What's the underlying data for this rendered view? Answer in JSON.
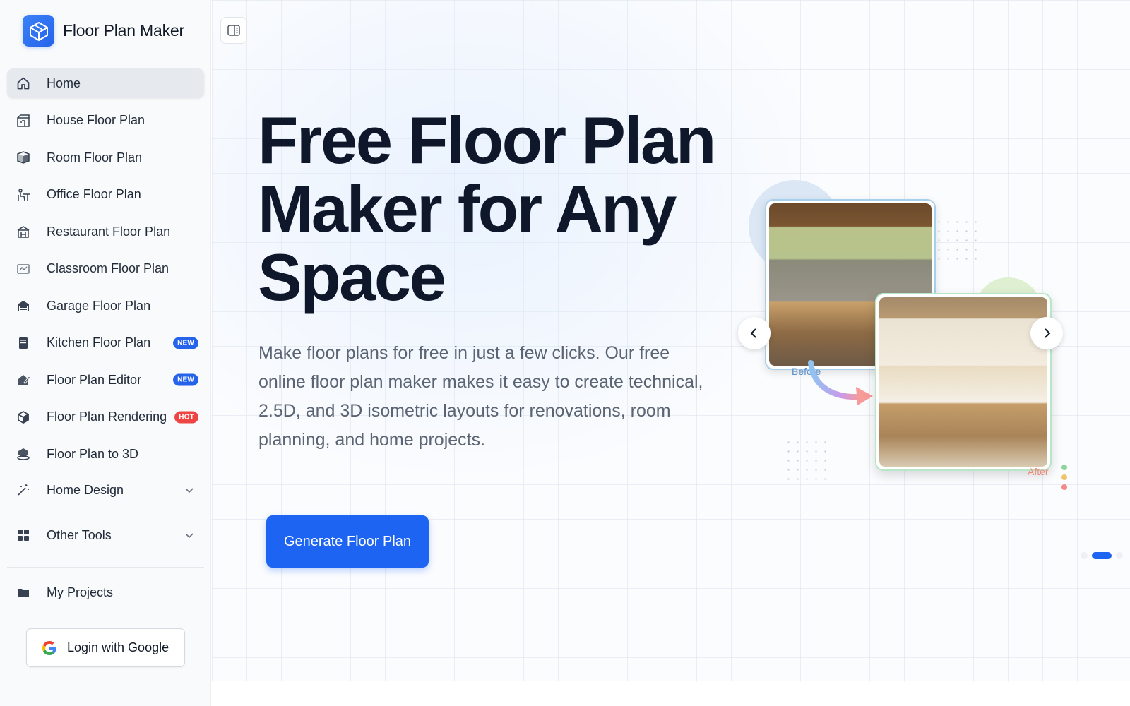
{
  "brand": {
    "title": "Floor Plan Maker"
  },
  "sidebar": {
    "items": [
      {
        "label": "Home",
        "icon": "home-icon",
        "active": true
      },
      {
        "label": "House Floor Plan",
        "icon": "house-plan-icon"
      },
      {
        "label": "Room Floor Plan",
        "icon": "room-cube-icon"
      },
      {
        "label": "Office Floor Plan",
        "icon": "office-desk-icon"
      },
      {
        "label": "Restaurant Floor Plan",
        "icon": "restaurant-icon"
      },
      {
        "label": "Classroom Floor Plan",
        "icon": "classroom-board-icon"
      },
      {
        "label": "Garage Floor Plan",
        "icon": "garage-icon"
      },
      {
        "label": "Kitchen Floor Plan",
        "icon": "kitchen-icon",
        "badge": "NEW"
      },
      {
        "label": "Floor Plan Editor",
        "icon": "editor-brush-icon",
        "badge": "NEW"
      },
      {
        "label": "Floor Plan Rendering",
        "icon": "render-cube-icon",
        "badge": "HOT"
      },
      {
        "label": "Floor Plan to 3D",
        "icon": "3d-icon"
      }
    ],
    "groups": [
      {
        "label": "Home Design",
        "icon": "magic-wand-icon"
      },
      {
        "label": "Other Tools",
        "icon": "grid-tiles-icon"
      }
    ],
    "my_projects": {
      "label": "My Projects",
      "icon": "folder-icon"
    },
    "login": {
      "label": "Login with Google",
      "icon": "google-icon"
    }
  },
  "hero": {
    "title": "Free Floor Plan Maker for Any Space",
    "description": "Make floor plans for free in just a few clicks. Our free online floor plan maker makes it easy to create technical, 2.5D, and 3D isometric layouts for renovations, room planning, and home projects.",
    "cta": "Generate Floor Plan"
  },
  "carousel": {
    "before_label": "Before",
    "after_label": "After",
    "pages": 3,
    "active_page": 2
  },
  "colors": {
    "accent": "#1d64f2",
    "badge_new": "#2563eb",
    "badge_hot": "#ef4444"
  }
}
